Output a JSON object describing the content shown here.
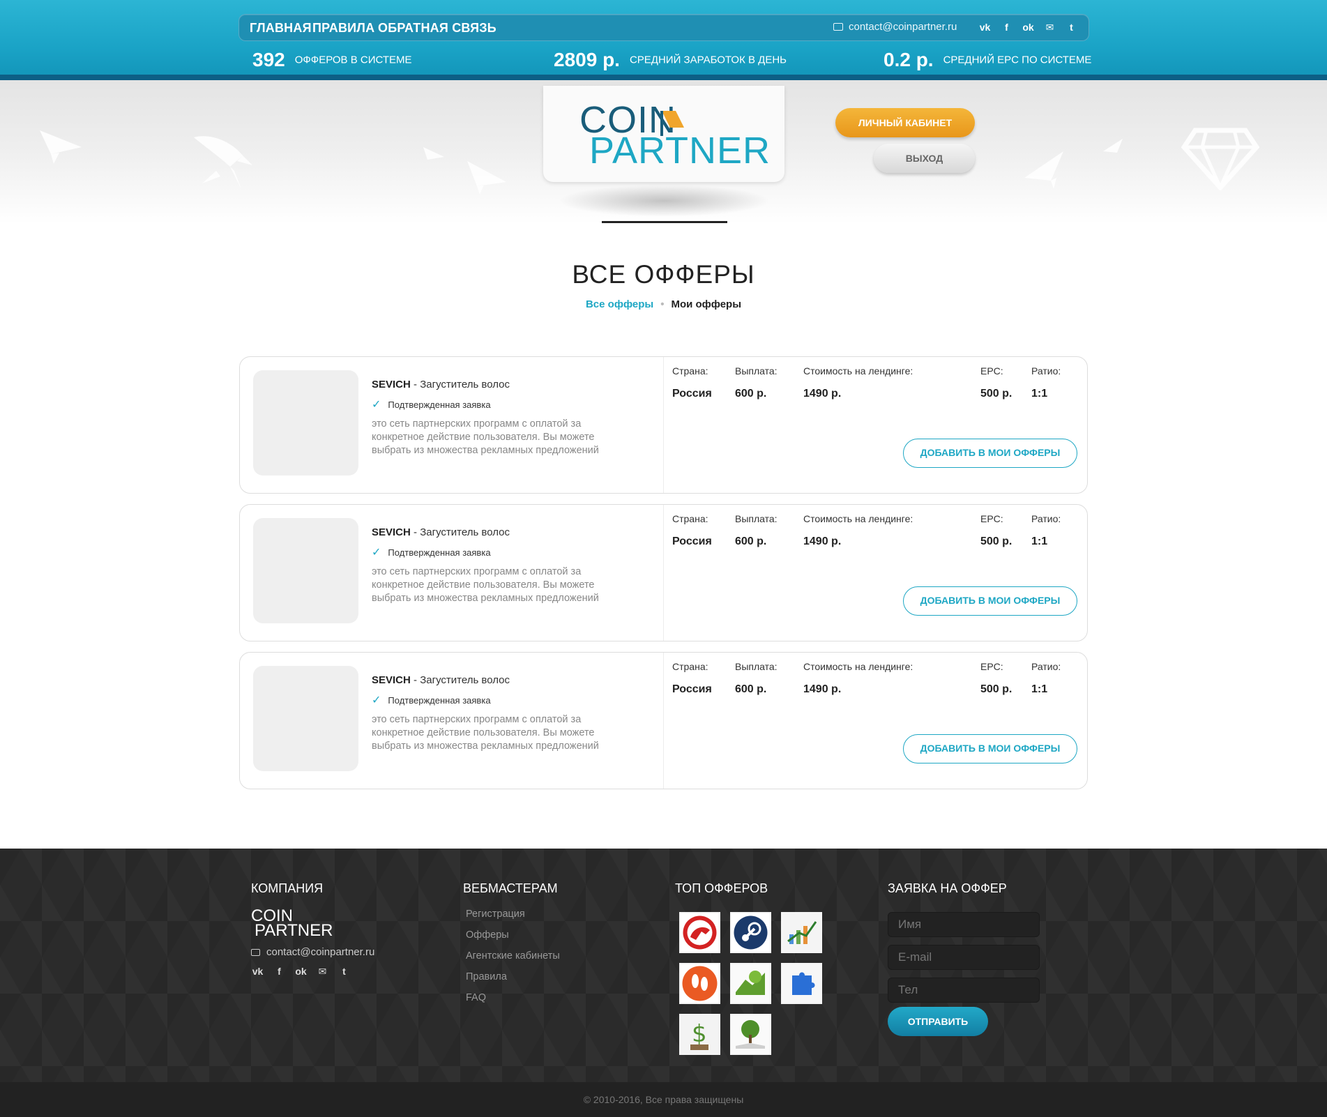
{
  "nav": {
    "items": [
      "Главная",
      "Правила",
      "Обратная связь"
    ],
    "email": "contact@coinpartner.ru"
  },
  "social_icons": [
    "vk-icon",
    "facebook-icon",
    "odnoklassniki-icon",
    "mail-icon",
    "twitter-icon"
  ],
  "stats": [
    {
      "value": "392",
      "label": "офферов в системе"
    },
    {
      "value": "2809 р.",
      "label": "средний заработок в день"
    },
    {
      "value": "0.2 р.",
      "label": "средний EPC по системе"
    }
  ],
  "logo": {
    "line1": "COIN",
    "line2": "PARTNER"
  },
  "header_buttons": {
    "cabinet": "Личный кабинет",
    "exit": "Выход"
  },
  "page": {
    "title": "ВСЕ ОФФЕРЫ",
    "tab_all": "Все офферы",
    "tab_separator": "•",
    "tab_my": "Мои офферы"
  },
  "offer_labels": {
    "country": "Страна:",
    "payout": "Выплата:",
    "landing_cost": "Стоимость на лендинге:",
    "epc": "EPC:",
    "ratio": "Ратио:",
    "add_button": "Добавить в мои офферы"
  },
  "offers": [
    {
      "brand": "SEVICH",
      "title": " - Загуститель волос",
      "status": "Подтвержденная заявка",
      "description": "это сеть партнерских программ с оплатой за конкретное действие пользователя. Вы можете выбрать из множества рекламных предложений",
      "country": "Россия",
      "payout": "600 р.",
      "landing_cost": "1490 р.",
      "epc": "500 р.",
      "ratio": "1:1"
    },
    {
      "brand": "SEVICH",
      "title": " - Загуститель волос",
      "status": "Подтвержденная заявка",
      "description": "это сеть партнерских программ с оплатой за конкретное действие пользователя. Вы можете выбрать из множества рекламных предложений",
      "country": "Россия",
      "payout": "600 р.",
      "landing_cost": "1490 р.",
      "epc": "500 р.",
      "ratio": "1:1"
    },
    {
      "brand": "SEVICH",
      "title": " - Загуститель волос",
      "status": "Подтвержденная заявка",
      "description": "это сеть партнерских программ с оплатой за конкретное действие пользователя. Вы можете выбрать из множества рекламных предложений",
      "country": "Россия",
      "payout": "600 р.",
      "landing_cost": "1490 р.",
      "epc": "500 р.",
      "ratio": "1:1"
    }
  ],
  "footer": {
    "company_heading": "КОМПАНИЯ",
    "webmasters_heading": "ВЕБМАСТЕРАМ",
    "top_heading": "ТОП ОФФЕРОВ",
    "request_heading": "ЗАЯВКА НА ОФФЕР",
    "logo_line1": "COIN",
    "logo_line2": "PARTNER",
    "email": "contact@coinpartner.ru",
    "links": [
      "Регистрация",
      "Офферы",
      "Агентские кабинеты",
      "Правила",
      "FAQ"
    ],
    "top_offer_icons": [
      "lion-logo-icon",
      "steam-icon",
      "chart-icon",
      "footprints-icon",
      "tree-puzzle-icon",
      "puzzle-icon",
      "money-tree-icon",
      "tree-book-icon"
    ],
    "form": {
      "name_placeholder": "Имя",
      "email_placeholder": "E-mail",
      "phone_placeholder": "Тел",
      "submit": "Отправить"
    },
    "copyright": "© 2010-2016, Все права защищены"
  },
  "colors": {
    "accent": "#1ea7c4",
    "orange": "#f0a52c",
    "dark": "#2b2b2b"
  }
}
